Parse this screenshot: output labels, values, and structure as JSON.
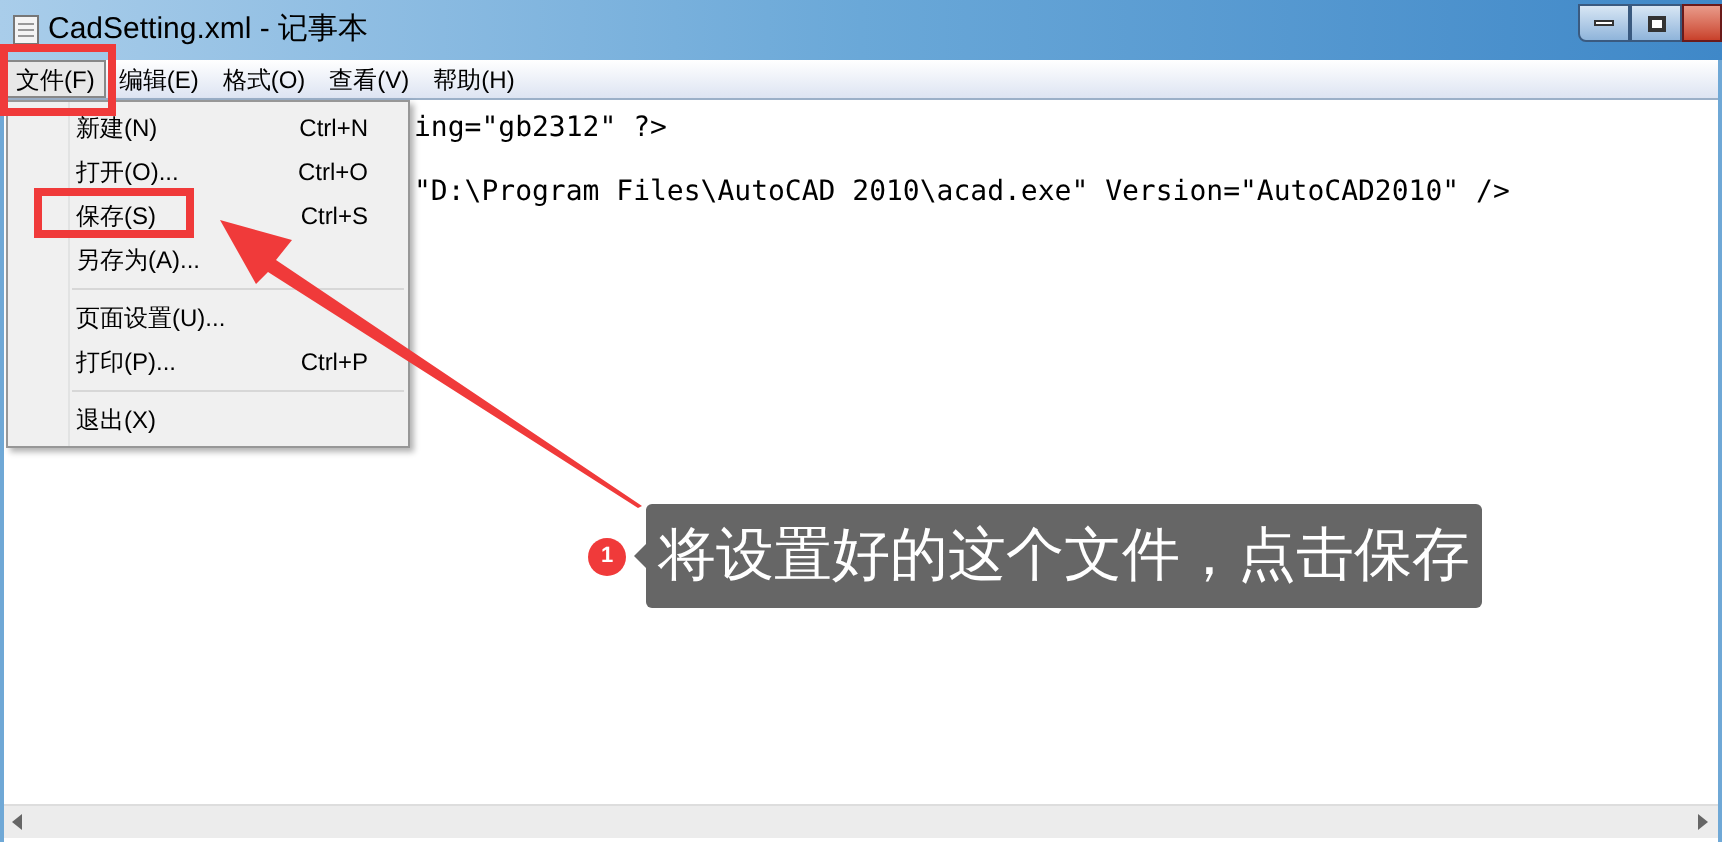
{
  "window": {
    "title": "CadSetting.xml - 记事本"
  },
  "menu_bar": [
    {
      "label": "文件(F)",
      "selected": true
    },
    {
      "label": "编辑(E)",
      "selected": false
    },
    {
      "label": "格式(O)",
      "selected": false
    },
    {
      "label": "查看(V)",
      "selected": false
    },
    {
      "label": "帮助(H)",
      "selected": false
    }
  ],
  "file_menu": [
    {
      "kind": "item",
      "label": "新建(N)",
      "shortcut": "Ctrl+N"
    },
    {
      "kind": "item",
      "label": "打开(O)...",
      "shortcut": "Ctrl+O"
    },
    {
      "kind": "item",
      "label": "保存(S)",
      "shortcut": "Ctrl+S"
    },
    {
      "kind": "item",
      "label": "另存为(A)..."
    },
    {
      "kind": "separator"
    },
    {
      "kind": "item",
      "label": "页面设置(U)..."
    },
    {
      "kind": "item",
      "label": "打印(P)...",
      "shortcut": "Ctrl+P"
    },
    {
      "kind": "separator"
    },
    {
      "kind": "item",
      "label": "退出(X)"
    }
  ],
  "editor_lines": [
    "ing=\"gb2312\" ?>",
    "\"D:\\Program Files\\AutoCAD 2010\\acad.exe\" Version=\"AutoCAD2010\" />"
  ],
  "callout": {
    "badge": "1",
    "text": "将设置好的这个文件，点击保存"
  }
}
